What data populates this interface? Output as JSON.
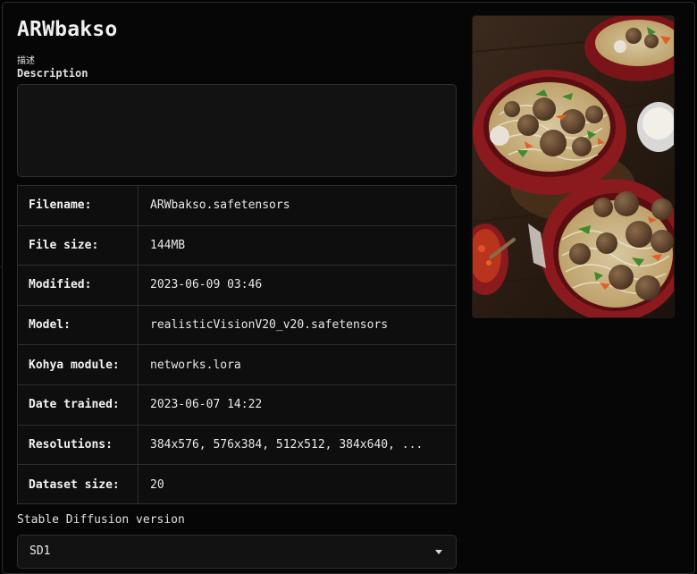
{
  "card": {
    "title": "ARWbakso",
    "description_label_cn": "描述",
    "description_label_en": "Description",
    "description_value": ""
  },
  "info": {
    "rows": [
      {
        "key": "Filename:",
        "value": "ARWbakso.safetensors"
      },
      {
        "key": "File size:",
        "value": "144MB"
      },
      {
        "key": "Modified:",
        "value": "2023-06-09 03:46"
      },
      {
        "key": "Model:",
        "value": "realisticVisionV20_v20.safetensors"
      },
      {
        "key": "Kohya module:",
        "value": "networks.lora"
      },
      {
        "key": "Date trained:",
        "value": "2023-06-07 14:22"
      },
      {
        "key": "Resolutions:",
        "value": "384x576, 576x384, 512x512, 384x640, ..."
      },
      {
        "key": "Dataset size:",
        "value": "20"
      }
    ]
  },
  "sd_version": {
    "label": "Stable Diffusion version",
    "selected": "SD1"
  },
  "icons": {
    "dropdown": "caret-down-icon"
  },
  "colors": {
    "background": "#000000",
    "panel": "#060606",
    "field": "#121212",
    "border": "#2e2e2e",
    "text": "#e8e8e8"
  }
}
